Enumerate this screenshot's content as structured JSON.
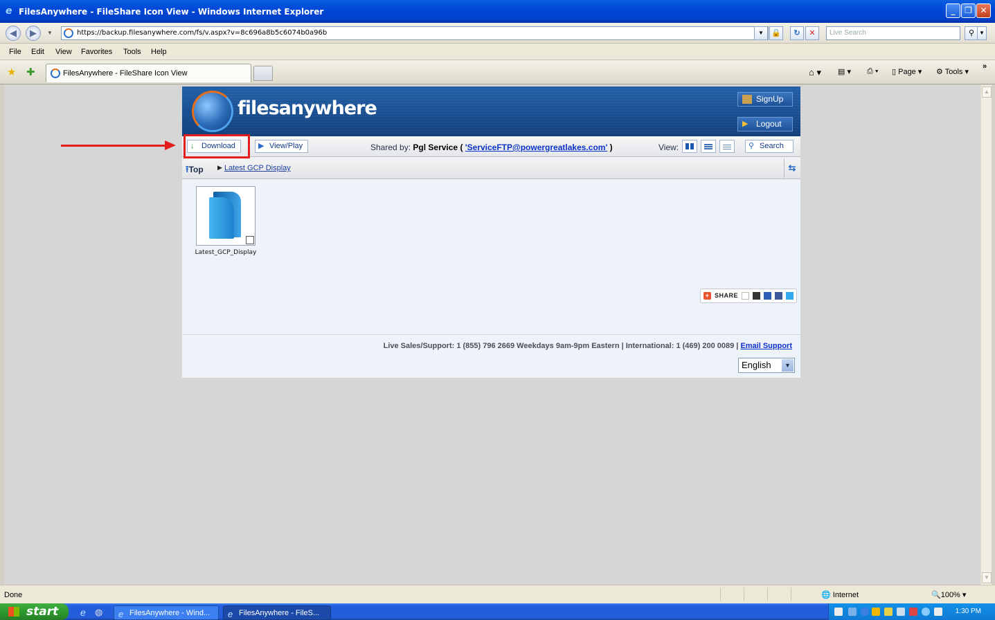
{
  "window": {
    "title": "FilesAnywhere - FileShare Icon View - Windows Internet Explorer"
  },
  "address": {
    "url": "https://backup.filesanywhere.com/fs/v.aspx?v=8c696a8b5c6074b0a96b",
    "search_placeholder": "Live Search"
  },
  "menu": [
    "File",
    "Edit",
    "View",
    "Favorites",
    "Tools",
    "Help"
  ],
  "tab": {
    "title": "FilesAnywhere - FileShare Icon View"
  },
  "commandbar": {
    "page": "Page",
    "tools": "Tools"
  },
  "site": {
    "logo": "filesanywhere",
    "signup": "SignUp",
    "logout": "Logout",
    "download": "Download",
    "viewplay": "View/Play",
    "shared_by_label": "Shared by:",
    "shared_by_name": "Pgl Service",
    "shared_by_email": "'ServiceFTP@powergreatlakes.com'",
    "view_label": "View:",
    "search": "Search",
    "crumb_top": "Top",
    "crumb_folder": "Latest GCP Display",
    "file_name": "Latest_GCP_Display",
    "share": "SHARE",
    "support_text": "Live Sales/Support: 1 (855) 796 2669  Weekdays 9am-9pm Eastern |  International: 1 (469) 200 0089  | ",
    "email_support": "Email Support",
    "language": "English"
  },
  "status": {
    "text": "Done",
    "zone": "Internet",
    "zoom": "100%"
  },
  "taskbar": {
    "start": "start",
    "items": [
      "FilesAnywhere - Wind...",
      "FilesAnywhere - FileS..."
    ],
    "clock": "1:30 PM"
  }
}
